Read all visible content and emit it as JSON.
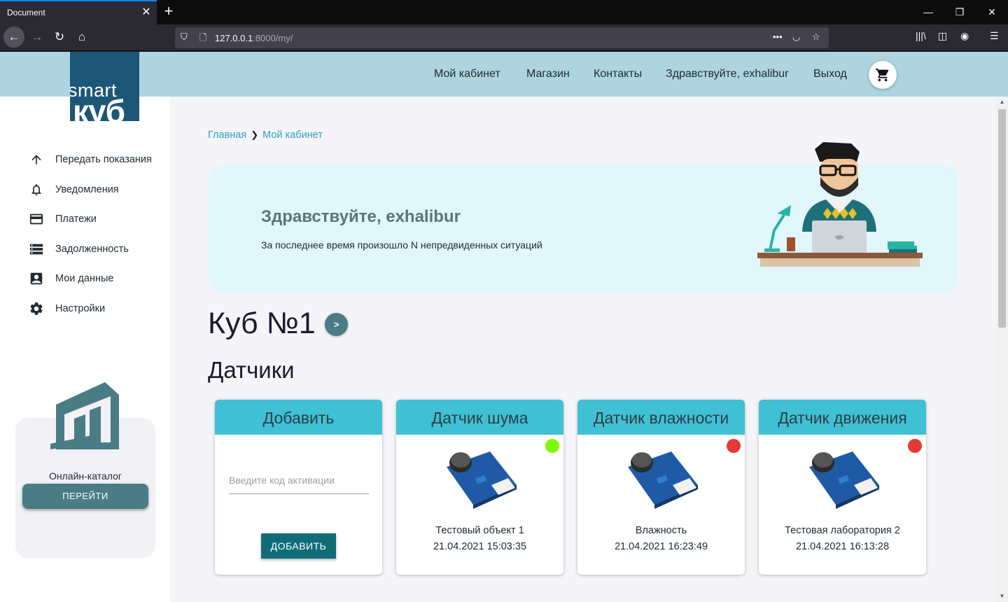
{
  "browser": {
    "tab_title": "Document",
    "url_host": "127.0.0.1",
    "url_rest": ":8000/my/"
  },
  "header": {
    "logo_top": "smart",
    "logo_bottom": "куб",
    "menu": [
      "Мой кабинет",
      "Магазин",
      "Контакты",
      "Здравствуйте, exhalibur",
      "Выход"
    ]
  },
  "sidebar": {
    "items": [
      {
        "label": "Передать показания",
        "icon": "arrow-up-icon"
      },
      {
        "label": "Уведомления",
        "icon": "bell-icon"
      },
      {
        "label": "Платежи",
        "icon": "credit-card-icon"
      },
      {
        "label": "Задолженность",
        "icon": "list-icon"
      },
      {
        "label": "Мои данные",
        "icon": "contact-card-icon"
      },
      {
        "label": "Настройки",
        "icon": "gear-icon"
      }
    ],
    "catalog": {
      "title": "Онлайн-каталог",
      "button": "ПЕРЕЙТИ"
    }
  },
  "main": {
    "breadcrumb": [
      "Главная",
      "Мой кабинет"
    ],
    "banner": {
      "title": "Здравствуйте, exhalibur",
      "text": "За последнее время произошло N непредвиденных ситуаций"
    },
    "cube_title": "Куб №1",
    "sensors_title": "Датчики",
    "add_card": {
      "title": "Добавить",
      "placeholder": "Введите код активации",
      "button": "ДОБАВИТЬ"
    },
    "sensors": [
      {
        "title": "Датчик шума",
        "name": "Тестовый объект 1",
        "date": "21.04.2021 15:03:35",
        "status": "online",
        "status_color": "#7cfc00"
      },
      {
        "title": "Датчик влажности",
        "name": "Влажность",
        "date": "21.04.2021 16:23:49",
        "status": "offline",
        "status_color": "#e53935"
      },
      {
        "title": "Датчик движения",
        "name": "Тестовая лаборатория 2",
        "date": "21.04.2021 16:13:28",
        "status": "offline",
        "status_color": "#e53935"
      }
    ]
  },
  "colors": {
    "header_bg": "#add4df",
    "logo_bg": "#1d5777",
    "accent": "#3fc0d4",
    "button": "#4a7c86",
    "add_button": "#106d78"
  }
}
